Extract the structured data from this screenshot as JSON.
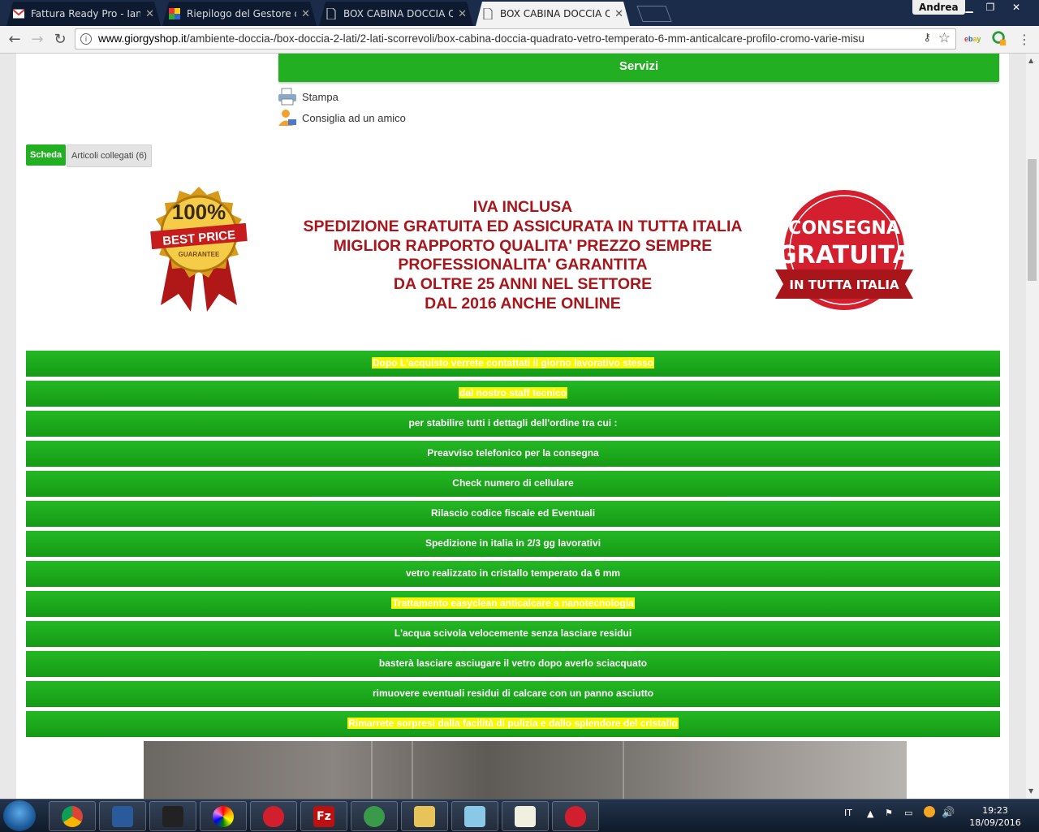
{
  "browser": {
    "tabs": [
      {
        "title": "Fattura Ready Pro - Ianer",
        "favicon": "gmail-icon",
        "active": false
      },
      {
        "title": "Riepilogo del Gestore de",
        "favicon": "colorful-grid-icon",
        "active": false
      },
      {
        "title": "BOX CABINA DOCCIA QU",
        "favicon": "page-icon",
        "active": false
      },
      {
        "title": "BOX CABINA DOCCIA QU",
        "favicon": "page-icon",
        "active": true
      }
    ],
    "user": "Andrea",
    "url_host": "www.giorgyshop.it",
    "url_path": "/ambiente-doccia-/box-doccia-2-lati/2-lati-scorrevoli/box-cabina-doccia-quadrato-vetro-temperato-6-mm-anticalcare-profilo-cromo-varie-misu"
  },
  "page": {
    "services_label": "Servizi",
    "tools": [
      {
        "label": "Stampa",
        "icon": "printer-icon"
      },
      {
        "label": "Consiglia ad un amico",
        "icon": "user-mail-icon"
      }
    ],
    "tabs": [
      {
        "label": "Scheda",
        "selected": true
      },
      {
        "label": "Articoli collegati (6)",
        "selected": false
      }
    ],
    "banner": {
      "badge_left": {
        "big": "100%",
        "mid": "BEST PRICE",
        "small": "GUARANTEE"
      },
      "lines": [
        "IVA INCLUSA",
        "SPEDIZIONE GRATUITA ED ASSICURATA IN TUTTA ITALIA",
        "MIGLIOR RAPPORTO QUALITA' PREZZO SEMPRE",
        "PROFESSIONALITA' GARANTITA",
        "DA OLTRE 25 ANNI NEL SETTORE",
        "DAL 2016 ANCHE ONLINE"
      ],
      "badge_right": {
        "top": "CONSEGNA",
        "mid": "GRATUITA",
        "ribbon": "IN TUTTA ITALIA"
      }
    },
    "info_rows": [
      {
        "text": "Dopo L'acquisto verrete contattati il giorno lavorativo stesso",
        "highlight": true
      },
      {
        "text": "dal nostro staff tecnico",
        "highlight": true
      },
      {
        "text": "per stabilire tutti i dettagli dell'ordine tra cui :",
        "highlight": false
      },
      {
        "text": "Preavviso telefonico per la consegna",
        "highlight": false
      },
      {
        "text": "Check numero di cellulare",
        "highlight": false
      },
      {
        "text": "Rilascio codice fiscale ed Eventuali",
        "highlight": false
      },
      {
        "text": "Spedizione in italia in 2/3 gg lavorativi",
        "highlight": false
      },
      {
        "text": "vetro realizzato in cristallo temperato da 6 mm",
        "highlight": false
      },
      {
        "text": "Trattamento easyclean anticalcare a nanotecnologia",
        "highlight": true
      },
      {
        "text": "L'acqua scivola velocemente senza lasciare residui",
        "highlight": false
      },
      {
        "text": "basterà lasciare asciugare il vetro dopo averlo sciacquato",
        "highlight": false
      },
      {
        "text": "rimuovere eventuali residui di calcare con un panno asciutto",
        "highlight": false
      },
      {
        "text": "Rimarrete sorpresi dalla facilità di pulizia e dallo splendore del cristallo",
        "highlight": true
      }
    ]
  },
  "taskbar": {
    "language": "IT",
    "time": "19:23",
    "date": "18/09/2016",
    "apps": [
      "chrome-icon",
      "network-drive-icon",
      "vodafone-icon",
      "color-wheel-icon",
      "strawberry-icon",
      "filezilla-icon",
      "gear-app-icon",
      "file-explorer-icon",
      "notepad-icon",
      "editor-icon",
      "strawberry-icon"
    ],
    "filezilla_glyph": "Fz"
  },
  "colors": {
    "green": "#22b022",
    "banner_red": "#a8151b",
    "highlight": "#f8f800"
  }
}
